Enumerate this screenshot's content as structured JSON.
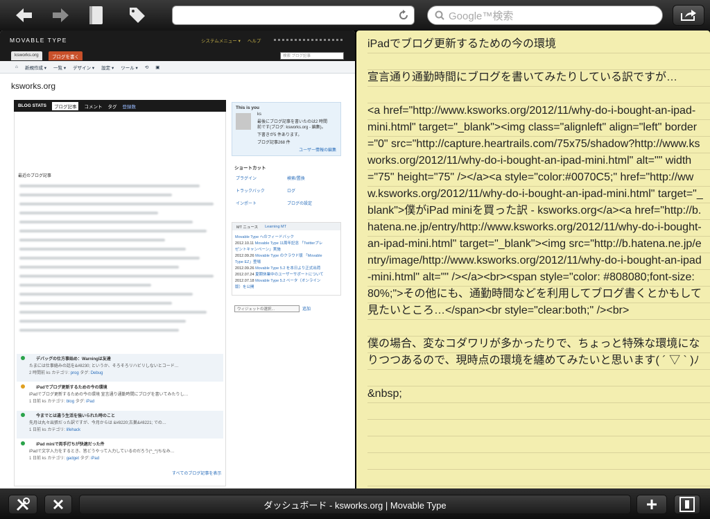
{
  "toolbar": {
    "back_icon": "back-arrow-icon",
    "forward_icon": "forward-arrow-icon",
    "url_value": "",
    "search_placeholder": "Google™検索"
  },
  "mt": {
    "logo": "MOVABLE TYPE",
    "menu": [
      "システムメニュー ▾",
      "ヘルプ"
    ],
    "site_tab": "ksworks.org",
    "write_tab": "ブログを書く",
    "search_placeholder": "検索 ブログ記事",
    "nav": [
      "新規作成 ▾",
      "一覧 ▾",
      "デザイン ▾",
      "設定 ▾",
      "ツール ▾"
    ],
    "site_name": "ksworks.org",
    "stats": {
      "title": "BLOG STATS",
      "tabs": [
        "ブログ記事",
        "コメント",
        "タグ",
        "登録数"
      ]
    },
    "recent_label": "最近のブログ記事",
    "entries": [
      {
        "title": "デバッグの仕方事始め：Warningは友達",
        "excerpt": "たまには仕事絡みの話を&#8230; というか、そろそろリハビリしないとコード…",
        "meta_a": "2 時間前 ks カテゴリ: ",
        "cat": "prog",
        "tag_lbl": " タグ: ",
        "tag": "Debug",
        "status": "published"
      },
      {
        "title": "iPadでブログ更新するための今の環境",
        "excerpt": "iPadでブログ更新するための今の環境 宣言通り通勤時間にブログを書いてみたりし…",
        "meta_a": "1 日前 ks カテゴリ: ",
        "cat": "blog",
        "tag_lbl": " タグ: ",
        "tag": "iPad",
        "status": "draft"
      },
      {
        "title": "今までとは違う生活を強いられた時のこと",
        "excerpt": "先月は丸々出張だった訳ですが、今月からは &#8220;古巣&#8221; での…",
        "meta_a": "1 日前 ks カテゴリ: ",
        "cat": "lifehack",
        "tag_lbl": "",
        "tag": "",
        "status": "published"
      },
      {
        "title": "iPad miniで両手打ちが快適だった件",
        "excerpt": "iPadで文字入力をするとき、皆どうやって入力しているのだろう(^_^)ちなみ…",
        "meta_a": "1 日前 ks カテゴリ: ",
        "cat": "gadget",
        "tag_lbl": " タグ: ",
        "tag": "iPad",
        "status": "published"
      }
    ],
    "all_posts": "すべてのブログ記事を表示",
    "you": {
      "title": "This is you",
      "name": "ks",
      "lines": [
        "最後にブログ記事を書いたのは2 時間",
        "前です(ブログ: ksworks.org - 編集)。",
        "下書きが5 件あります。",
        "ブログ記事268 件"
      ],
      "edit": "ユーザー情報の編集"
    },
    "shortcut": {
      "title": "ショートカット",
      "items": [
        "プラグイン",
        "検索/置換",
        "トラックバック",
        "ログ",
        "インポート",
        "ブログの設定"
      ]
    },
    "news": {
      "tabs": [
        "MT ニュース",
        "Learning MT"
      ],
      "feedback": "Movable Type へのフィードバック",
      "items": [
        {
          "date": "2012.10.11",
          "text": "Movable Type 11周年記念 「Twitterプレ"
        },
        {
          "date": "",
          "text": "ゼントキャンペーン」実施"
        },
        {
          "date": "2012.09.26",
          "text": "Movable Type のクラウド版 「Movable"
        },
        {
          "date": "",
          "text": "Type EZ」登場"
        },
        {
          "date": "2012.09.26",
          "text": "Movable Type 5.2 を本日より正式出荷"
        },
        {
          "date": "2012.07.24",
          "text": "夏期休業中のユーザーサポートについて"
        },
        {
          "date": "2012.07.18",
          "text": "Movable Type 5.2 ベータ（オンライン"
        },
        {
          "date": "",
          "text": "版）を公開"
        }
      ]
    },
    "widget_select": "ウィジェットの選択...",
    "add_button": "追加"
  },
  "note": {
    "paragraphs": [
      "iPadでブログ更新するための今の環境",
      "",
      "宣言通り通勤時間にブログを書いてみたりしている訳ですが…",
      "",
      "<a href=\"http://www.ksworks.org/2012/11/why-do-i-bought-an-ipad-mini.html\" target=\"_blank\"><img class=\"alignleft\" align=\"left\" border=\"0\" src=\"http://capture.heartrails.com/75x75/shadow?http://www.ksworks.org/2012/11/why-do-i-bought-an-ipad-mini.html\" alt=\"\" width=\"75\" height=\"75\" /></a><a style=\"color:#0070C5;\" href=\"http://www.ksworks.org/2012/11/why-do-i-bought-an-ipad-mini.html\" target=\"_blank\">僕がiPad miniを買った訳 - ksworks.org</a><a href=\"http://b.hatena.ne.jp/entry/http://www.ksworks.org/2012/11/why-do-i-bought-an-ipad-mini.html\" target=\"_blank\"><img src=\"http://b.hatena.ne.jp/entry/image/http://www.ksworks.org/2012/11/why-do-i-bought-an-ipad-mini.html\" alt=\"\" /></a><br><span style=\"color: #808080;font-size: 80%;\">その他にも、通勤時間などを利用してブログ書くとかもして見たいところ…</span><br style=\"clear:both;\" /><br>",
      "",
      "僕の場合、変なコダワリが多かったりで、ちょっと特殊な環境になりつつあるので、現時点の環境を纏めてみたいと思います( ´ ▽ ` )ﾉ",
      "",
      "&nbsp;"
    ]
  },
  "bottom": {
    "title": "ダッシュボード - ksworks.org | Movable Type"
  }
}
